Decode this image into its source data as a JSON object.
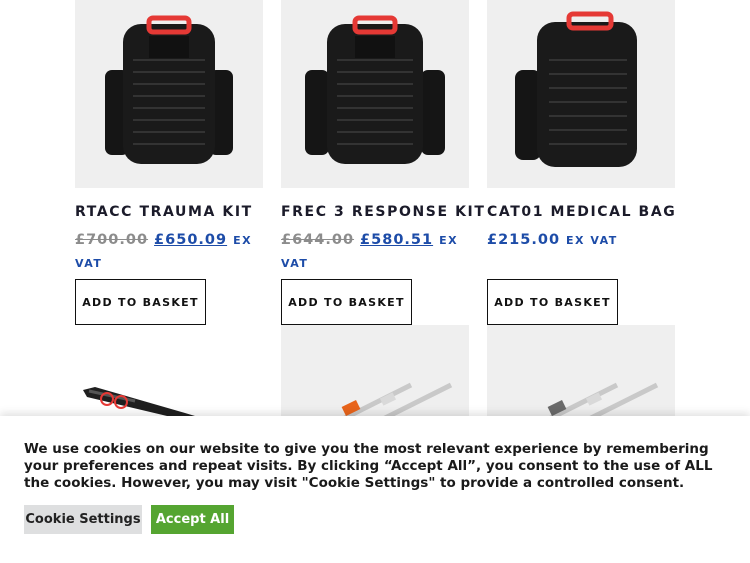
{
  "products": [
    {
      "name": "RTACC TRAUMA KIT",
      "old_price": "£700.00",
      "new_price": "£650.09",
      "suffix": "EX VAT",
      "button": "ADD TO BASKET"
    },
    {
      "name": "FREC 3 RESPONSE KIT",
      "old_price": "£644.00",
      "new_price": "£580.51",
      "suffix": "EX VAT",
      "button": "ADD TO BASKET"
    },
    {
      "name": "CAT01 MEDICAL BAG",
      "price": "£215.00",
      "suffix": "EX VAT",
      "button": "ADD TO BASKET"
    }
  ],
  "cookie": {
    "text": "We use cookies on our website to give you the most relevant experience by remembering your preferences and repeat visits. By clicking “Accept All”, you consent to the use of ALL the cookies. However, you may visit \"Cookie Settings\" to provide a controlled consent.",
    "settings_label": "Cookie Settings",
    "accept_label": "Accept All"
  },
  "colors": {
    "accent": "#1d4ca8",
    "accept": "#55a531"
  }
}
